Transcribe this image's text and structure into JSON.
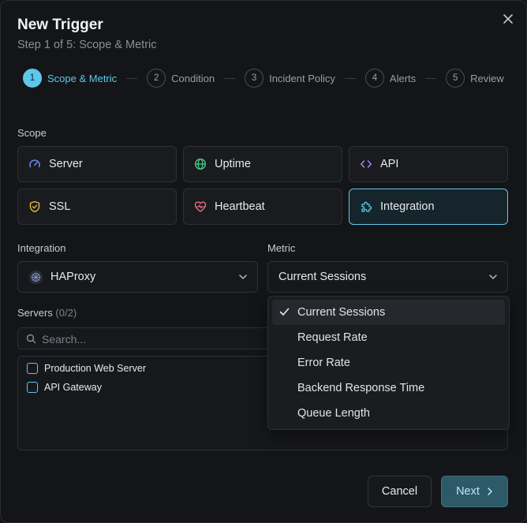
{
  "dialog": {
    "title": "New Trigger",
    "subtitle": "Step 1 of 5: Scope & Metric",
    "close_icon": "close-icon"
  },
  "stepper": [
    {
      "num": "1",
      "label": "Scope & Metric",
      "active": true
    },
    {
      "num": "2",
      "label": "Condition",
      "active": false
    },
    {
      "num": "3",
      "label": "Incident Policy",
      "active": false
    },
    {
      "num": "4",
      "label": "Alerts",
      "active": false
    },
    {
      "num": "5",
      "label": "Review",
      "active": false
    }
  ],
  "scope": {
    "label": "Scope",
    "options": [
      {
        "label": "Server",
        "icon": "gauge-icon",
        "selected": false
      },
      {
        "label": "Uptime",
        "icon": "globe-icon",
        "selected": false
      },
      {
        "label": "API",
        "icon": "code-icon",
        "selected": false
      },
      {
        "label": "SSL",
        "icon": "shield-check-icon",
        "selected": false
      },
      {
        "label": "Heartbeat",
        "icon": "heart-pulse-icon",
        "selected": false
      },
      {
        "label": "Integration",
        "icon": "puzzle-icon",
        "selected": true
      }
    ]
  },
  "integration": {
    "label": "Integration",
    "value": "HAProxy",
    "icon": "haproxy-logo-icon"
  },
  "metric": {
    "label": "Metric",
    "value": "Current Sessions",
    "options": [
      "Current Sessions",
      "Request Rate",
      "Error Rate",
      "Backend Response Time",
      "Queue Length"
    ],
    "selected_index": 0
  },
  "servers": {
    "label": "Servers",
    "count": "(0/2)",
    "search_placeholder": "Search...",
    "items": [
      "Production Web Server",
      "API Gateway"
    ]
  },
  "footer": {
    "cancel_label": "Cancel",
    "next_label": "Next"
  },
  "colors": {
    "accent": "#5ec8ec",
    "background": "#141518",
    "card": "#1a1b1f",
    "border": "#2e3036"
  }
}
